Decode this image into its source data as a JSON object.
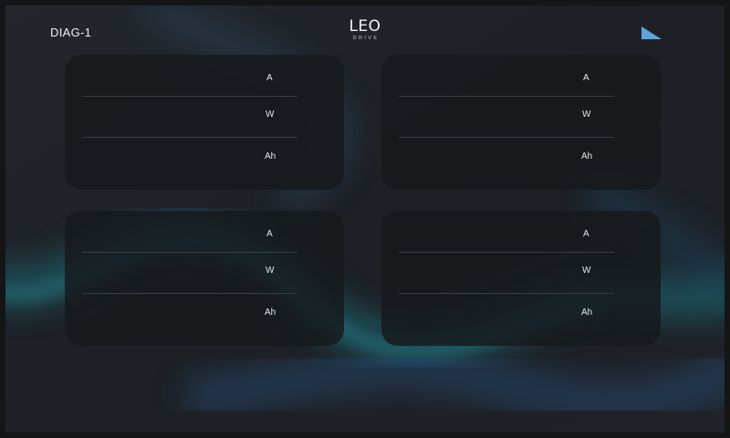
{
  "header": {
    "title": "DIAG-1",
    "logo_main": "LEO",
    "logo_sub": "DRIVE",
    "signal_icon": "signal-strength-icon",
    "accent_color": "#5aa7dc"
  },
  "cards": [
    {
      "current_value": "",
      "current_unit": "A",
      "power_value": "",
      "power_unit": "W",
      "capacity_value": "",
      "capacity_unit": "Ah"
    },
    {
      "current_value": "",
      "current_unit": "A",
      "power_value": "",
      "power_unit": "W",
      "capacity_value": "",
      "capacity_unit": "Ah"
    },
    {
      "current_value": "",
      "current_unit": "A",
      "power_value": "",
      "power_unit": "W",
      "capacity_value": "",
      "capacity_unit": "Ah"
    },
    {
      "current_value": "",
      "current_unit": "A",
      "power_value": "",
      "power_unit": "W",
      "capacity_value": "",
      "capacity_unit": "Ah"
    }
  ]
}
